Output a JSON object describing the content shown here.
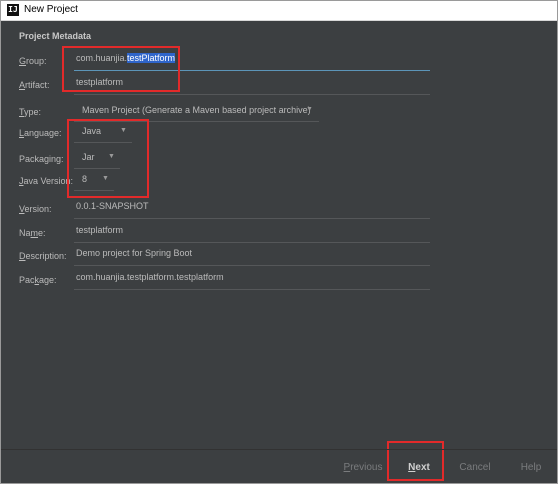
{
  "window": {
    "icon_text": "IJ",
    "title": "New Project"
  },
  "section_title": "Project Metadata",
  "fields": {
    "group": {
      "label_u": "G",
      "label_rest": "roup:",
      "value_prefix": "com.huanjia.",
      "value_selected": "testPlatform"
    },
    "artifact": {
      "label_u": "A",
      "label_rest": "rtifact:",
      "value": "testplatform"
    },
    "type": {
      "label_u": "T",
      "label_rest": "ype:",
      "value": "Maven Project (Generate a Maven based project archive)"
    },
    "language": {
      "label_u": "L",
      "label_rest": "anguage:",
      "value": "Java"
    },
    "packaging": {
      "label_pre": "Packa",
      "label_u": "g",
      "label_rest": "ing:",
      "value": "Jar"
    },
    "java_version": {
      "label_u": "J",
      "label_rest": "ava Version:",
      "value": "8"
    },
    "version": {
      "label_u": "V",
      "label_rest": "ersion:",
      "value": "0.0.1-SNAPSHOT"
    },
    "name": {
      "label_pre": "Na",
      "label_u": "m",
      "label_rest": "e:",
      "value": "testplatform"
    },
    "description": {
      "label_u": "D",
      "label_rest": "escription:",
      "value": "Demo project for Spring Boot"
    },
    "package": {
      "label_pre": "Pac",
      "label_u": "k",
      "label_rest": "age:",
      "value": "com.huanjia.testplatform.testplatform"
    }
  },
  "icons": {
    "dropdown": "chevron-down-icon"
  },
  "buttons": {
    "previous": {
      "u": "P",
      "rest": "revious"
    },
    "next": {
      "u": "N",
      "rest": "ext"
    },
    "cancel": "Cancel",
    "help": "Help"
  },
  "colors": {
    "background": "#3c3f41",
    "text": "#bbbbbb",
    "selection": "#2f65ca",
    "highlight_box": "#e22a2a",
    "focus_line": "#5c95b8"
  }
}
